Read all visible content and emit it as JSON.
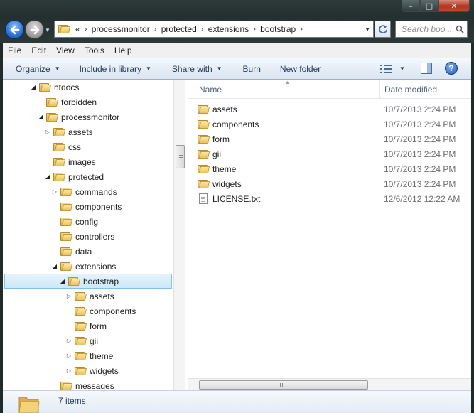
{
  "window": {
    "controls": {
      "minimize": "–",
      "maximize": "□",
      "close": "✕"
    }
  },
  "address": {
    "chevron": "«",
    "crumbs": [
      "processmonitor",
      "protected",
      "extensions",
      "bootstrap"
    ],
    "search_placeholder": "Search boo..."
  },
  "menu": [
    "File",
    "Edit",
    "View",
    "Tools",
    "Help"
  ],
  "toolbar": {
    "organize": "Organize",
    "include": "Include in library",
    "share": "Share with",
    "burn": "Burn",
    "new_folder": "New folder",
    "help": "?"
  },
  "tree": [
    {
      "label": "htdocs",
      "expander": "open",
      "indent": 0
    },
    {
      "label": "forbidden",
      "expander": "none",
      "indent": 1
    },
    {
      "label": "processmonitor",
      "expander": "open",
      "indent": 1
    },
    {
      "label": "assets",
      "expander": "closed",
      "indent": 2
    },
    {
      "label": "css",
      "expander": "none",
      "indent": 2
    },
    {
      "label": "images",
      "expander": "none",
      "indent": 2
    },
    {
      "label": "protected",
      "expander": "open",
      "indent": 2
    },
    {
      "label": "commands",
      "expander": "closed",
      "indent": 3
    },
    {
      "label": "components",
      "expander": "none",
      "indent": 3
    },
    {
      "label": "config",
      "expander": "none",
      "indent": 3
    },
    {
      "label": "controllers",
      "expander": "none",
      "indent": 3
    },
    {
      "label": "data",
      "expander": "none",
      "indent": 3
    },
    {
      "label": "extensions",
      "expander": "open",
      "indent": 3
    },
    {
      "label": "bootstrap",
      "expander": "open",
      "indent": 4,
      "selected": true
    },
    {
      "label": "assets",
      "expander": "closed",
      "indent": 5
    },
    {
      "label": "components",
      "expander": "none",
      "indent": 5
    },
    {
      "label": "form",
      "expander": "none",
      "indent": 5
    },
    {
      "label": "gii",
      "expander": "closed",
      "indent": 5
    },
    {
      "label": "theme",
      "expander": "closed",
      "indent": 5
    },
    {
      "label": "widgets",
      "expander": "closed",
      "indent": 5
    },
    {
      "label": "messages",
      "expander": "none",
      "indent": 3
    }
  ],
  "columns": {
    "name": "Name",
    "date": "Date modified"
  },
  "files": [
    {
      "name": "assets",
      "date": "10/7/2013 2:24 PM",
      "type": "folder"
    },
    {
      "name": "components",
      "date": "10/7/2013 2:24 PM",
      "type": "folder"
    },
    {
      "name": "form",
      "date": "10/7/2013 2:24 PM",
      "type": "folder"
    },
    {
      "name": "gii",
      "date": "10/7/2013 2:24 PM",
      "type": "folder"
    },
    {
      "name": "theme",
      "date": "10/7/2013 2:24 PM",
      "type": "folder"
    },
    {
      "name": "widgets",
      "date": "10/7/2013 2:24 PM",
      "type": "folder"
    },
    {
      "name": "LICENSE.txt",
      "date": "12/6/2012 12:22 AM",
      "type": "text-file"
    }
  ],
  "status": {
    "item_count": "7 items"
  }
}
